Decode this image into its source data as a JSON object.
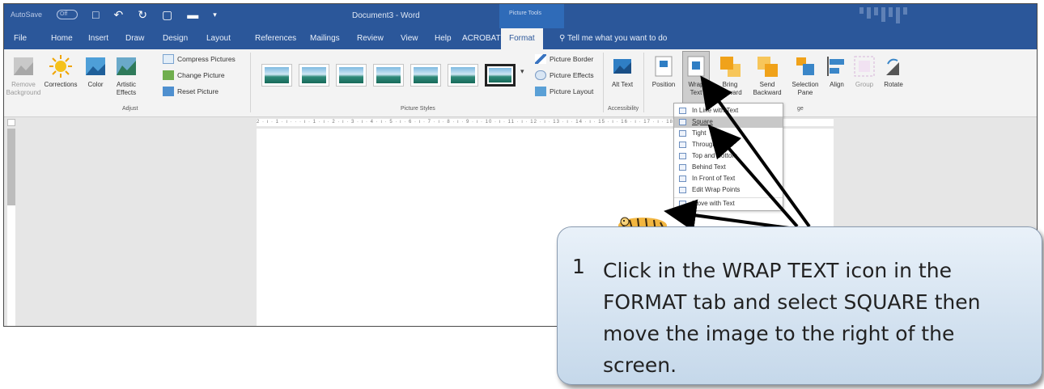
{
  "titlebar": {
    "autosave_label": "AutoSave",
    "autosave_state": "Off",
    "document_title": "Document3  -  Word",
    "context_group": "Picture Tools"
  },
  "tabs": [
    "File",
    "Home",
    "Insert",
    "Draw",
    "Design",
    "Layout",
    "References",
    "Mailings",
    "Review",
    "View",
    "Help",
    "ACROBAT",
    "Format"
  ],
  "active_tab": "Format",
  "tell_me": "Tell me what you want to do",
  "ribbon": {
    "remove_background": "Remove Background",
    "corrections": "Corrections",
    "color": "Color",
    "artistic_effects": "Artistic Effects",
    "compress_pictures": "Compress Pictures",
    "change_picture": "Change Picture",
    "reset_picture": "Reset Picture",
    "adjust_group": "Adjust",
    "picture_styles_group": "Picture Styles",
    "picture_border": "Picture Border",
    "picture_effects": "Picture Effects",
    "picture_layout": "Picture Layout",
    "alt_text": "Alt Text",
    "accessibility_group": "Accessibility",
    "position": "Position",
    "wrap_text": "Wrap Text",
    "bring_forward": "Bring Forward",
    "send_backward": "Send Backward",
    "selection_pane": "Selection Pane",
    "align": "Align",
    "group": "Group",
    "rotate": "Rotate",
    "arrange_group": "ge"
  },
  "ruler_text": "2 · ı · 1 · ı · · · ı · 1 · ı · 2 · ı · 3 · ı · 4 · ı · 5 · ı · 6 · ı · 7 · ı · 8 · ı · 9 · ı · 10 · ı · 11 · ı · 12 · ı · 13 · ı · 14 · ı · 15 · ı · 16 · ı · 17 · ı · 18 ·",
  "wrap_menu": {
    "items": [
      "In Line with Text",
      "Square",
      "Tight",
      "Through",
      "Top and Bottom",
      "Behind Text",
      "In Front of Text",
      "Edit Wrap Points",
      "Move with Text"
    ],
    "selected": "Square"
  },
  "callout": {
    "number": "1",
    "text": "Click in the WRAP TEXT icon in the FORMAT tab and select SQUARE then move the image to the right of the screen."
  },
  "colors": {
    "title_bar": "#2b579a",
    "ribbon": "#f3f3f3",
    "callout_fill": "#c5d8ea"
  }
}
